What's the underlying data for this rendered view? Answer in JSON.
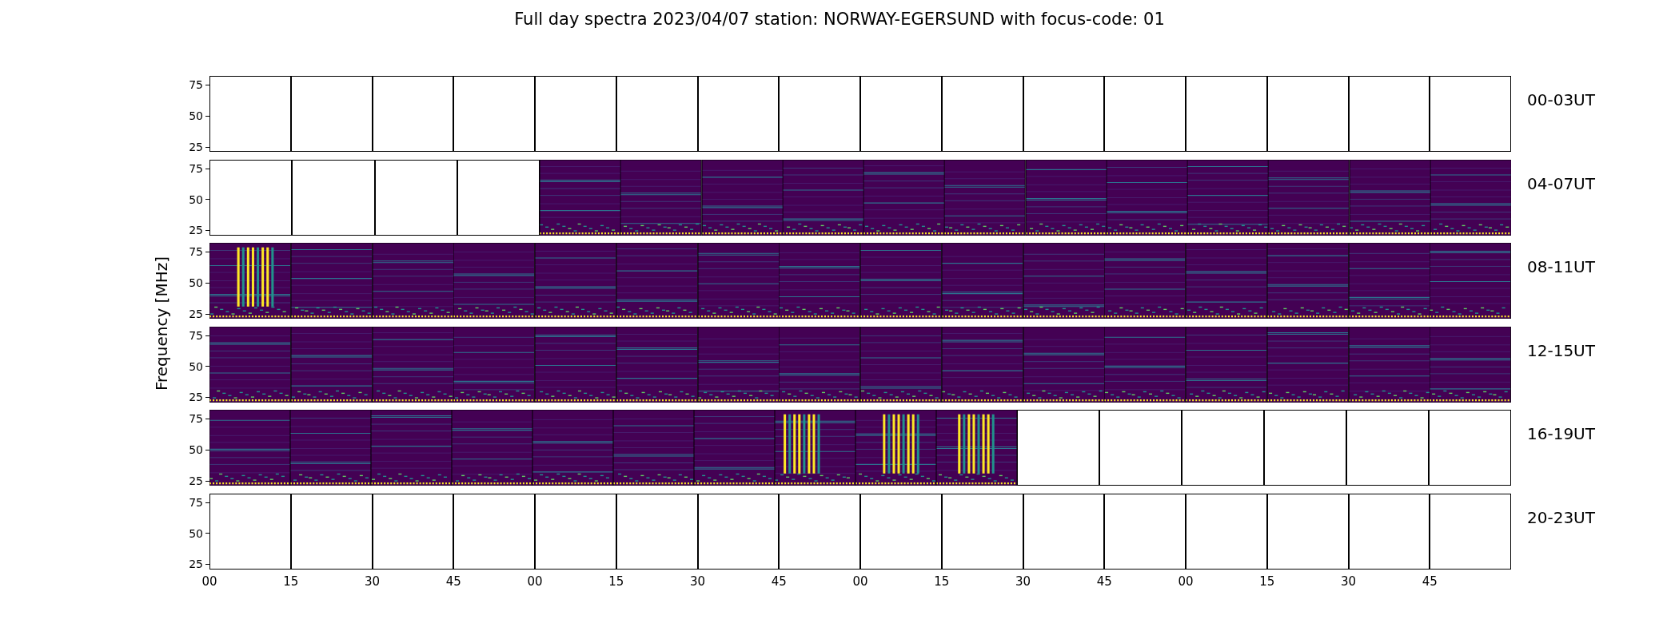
{
  "title": "Full day spectra 2023/04/07 station: NORWAY-EGERSUND with focus-code: 01",
  "ylabel": "Frequency [MHz]",
  "rows": [
    {
      "label": "00-03UT",
      "yticks": [
        "75",
        "50",
        "25"
      ],
      "panels": [
        {
          "kind": "empty"
        },
        {
          "kind": "empty"
        },
        {
          "kind": "empty"
        },
        {
          "kind": "empty"
        },
        {
          "kind": "empty"
        },
        {
          "kind": "empty"
        },
        {
          "kind": "empty"
        },
        {
          "kind": "empty"
        },
        {
          "kind": "empty"
        },
        {
          "kind": "empty"
        },
        {
          "kind": "empty"
        },
        {
          "kind": "empty"
        },
        {
          "kind": "empty"
        },
        {
          "kind": "empty"
        },
        {
          "kind": "empty"
        },
        {
          "kind": "empty"
        }
      ]
    },
    {
      "label": "04-07UT",
      "yticks": [
        "75",
        "50",
        "25"
      ],
      "panels": [
        {
          "kind": "empty"
        },
        {
          "kind": "empty"
        },
        {
          "kind": "empty"
        },
        {
          "kind": "empty"
        },
        {
          "kind": "spectrum"
        },
        {
          "kind": "spectrum"
        },
        {
          "kind": "spectrum"
        },
        {
          "kind": "spectrum"
        },
        {
          "kind": "spectrum"
        },
        {
          "kind": "spectrum"
        },
        {
          "kind": "spectrum"
        },
        {
          "kind": "spectrum"
        },
        {
          "kind": "spectrum"
        },
        {
          "kind": "spectrum"
        },
        {
          "kind": "spectrum"
        },
        {
          "kind": "spectrum"
        }
      ]
    },
    {
      "label": "08-11UT",
      "yticks": [
        "75",
        "50",
        "25"
      ],
      "panels": [
        {
          "kind": "burst"
        },
        {
          "kind": "spectrum"
        },
        {
          "kind": "spectrum"
        },
        {
          "kind": "spectrum"
        },
        {
          "kind": "spectrum"
        },
        {
          "kind": "spectrum"
        },
        {
          "kind": "spectrum"
        },
        {
          "kind": "spectrum"
        },
        {
          "kind": "spectrum"
        },
        {
          "kind": "spectrum"
        },
        {
          "kind": "spectrum"
        },
        {
          "kind": "spectrum"
        },
        {
          "kind": "spectrum"
        },
        {
          "kind": "spectrum"
        },
        {
          "kind": "spectrum"
        },
        {
          "kind": "spectrum"
        }
      ]
    },
    {
      "label": "12-15UT",
      "yticks": [
        "75",
        "50",
        "25"
      ],
      "panels": [
        {
          "kind": "spectrum"
        },
        {
          "kind": "spectrum"
        },
        {
          "kind": "spectrum"
        },
        {
          "kind": "spectrum"
        },
        {
          "kind": "spectrum"
        },
        {
          "kind": "spectrum"
        },
        {
          "kind": "spectrum"
        },
        {
          "kind": "spectrum"
        },
        {
          "kind": "spectrum"
        },
        {
          "kind": "spectrum"
        },
        {
          "kind": "spectrum"
        },
        {
          "kind": "spectrum"
        },
        {
          "kind": "spectrum"
        },
        {
          "kind": "spectrum"
        },
        {
          "kind": "spectrum"
        },
        {
          "kind": "spectrum"
        }
      ]
    },
    {
      "label": "16-19UT",
      "yticks": [
        "75",
        "50",
        "25"
      ],
      "panels": [
        {
          "kind": "spectrum"
        },
        {
          "kind": "spectrum"
        },
        {
          "kind": "spectrum"
        },
        {
          "kind": "spectrum"
        },
        {
          "kind": "spectrum"
        },
        {
          "kind": "spectrum"
        },
        {
          "kind": "spectrum"
        },
        {
          "kind": "burst"
        },
        {
          "kind": "burst"
        },
        {
          "kind": "burst"
        },
        {
          "kind": "empty"
        },
        {
          "kind": "empty"
        },
        {
          "kind": "empty"
        },
        {
          "kind": "empty"
        },
        {
          "kind": "empty"
        },
        {
          "kind": "empty"
        }
      ]
    },
    {
      "label": "20-23UT",
      "yticks": [
        "75",
        "50",
        "25"
      ],
      "panels": [
        {
          "kind": "empty"
        },
        {
          "kind": "empty"
        },
        {
          "kind": "empty"
        },
        {
          "kind": "empty"
        },
        {
          "kind": "empty"
        },
        {
          "kind": "empty"
        },
        {
          "kind": "empty"
        },
        {
          "kind": "empty"
        },
        {
          "kind": "empty"
        },
        {
          "kind": "empty"
        },
        {
          "kind": "empty"
        },
        {
          "kind": "empty"
        },
        {
          "kind": "empty"
        },
        {
          "kind": "empty"
        },
        {
          "kind": "empty"
        },
        {
          "kind": "empty"
        }
      ]
    }
  ],
  "xticks": [
    "00",
    "15",
    "30",
    "45",
    "00",
    "15",
    "30",
    "45",
    "00",
    "15",
    "30",
    "45",
    "00",
    "15",
    "30",
    "45"
  ]
}
